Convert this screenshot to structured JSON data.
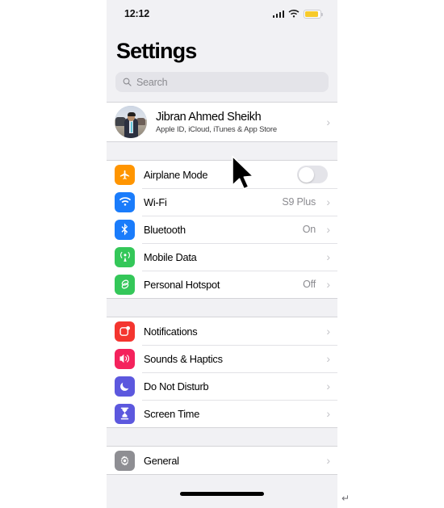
{
  "status_bar": {
    "time": "12:12",
    "signal_icon": "cellular-signal-icon",
    "wifi_icon": "wifi-icon",
    "battery_icon": "battery-icon",
    "battery_color": "#f7ca2b"
  },
  "header": {
    "title": "Settings"
  },
  "search": {
    "placeholder": "Search",
    "icon": "search-icon"
  },
  "profile": {
    "name": "Jibran Ahmed Sheikh",
    "subtitle": "Apple ID, iCloud, iTunes & App Store",
    "avatar": "user-avatar-photo",
    "chevron": "chevron-right-icon"
  },
  "groups": [
    {
      "id": "connectivity",
      "rows": [
        {
          "label": "Airplane Mode",
          "icon": "airplane-icon",
          "icon_color": "#FF9500",
          "control": "toggle",
          "toggle_on": false
        },
        {
          "label": "Wi-Fi",
          "icon": "wifi-icon",
          "icon_color": "#1A7CFB",
          "value": "S9 Plus",
          "control": "chevron"
        },
        {
          "label": "Bluetooth",
          "icon": "bluetooth-icon",
          "icon_color": "#1A7CFB",
          "value": "On",
          "control": "chevron"
        },
        {
          "label": "Mobile Data",
          "icon": "cellular-antenna-icon",
          "icon_color": "#34C759",
          "value": "",
          "control": "chevron"
        },
        {
          "label": "Personal Hotspot",
          "icon": "hotspot-link-icon",
          "icon_color": "#34C759",
          "value": "Off",
          "control": "chevron"
        }
      ]
    },
    {
      "id": "alerts",
      "rows": [
        {
          "label": "Notifications",
          "icon": "notifications-icon",
          "icon_color": "#F4352F",
          "value": "",
          "control": "chevron"
        },
        {
          "label": "Sounds & Haptics",
          "icon": "speaker-icon",
          "icon_color": "#F4225C",
          "value": "",
          "control": "chevron"
        },
        {
          "label": "Do Not Disturb",
          "icon": "moon-icon",
          "icon_color": "#5C58DE",
          "value": "",
          "control": "chevron"
        },
        {
          "label": "Screen Time",
          "icon": "hourglass-icon",
          "icon_color": "#5C58DE",
          "value": "",
          "control": "chevron"
        }
      ]
    },
    {
      "id": "system",
      "rows": [
        {
          "label": "General",
          "icon": "gear-icon",
          "icon_color": "#8E8E93",
          "value": "",
          "control": "chevron"
        }
      ]
    }
  ],
  "overlay": {
    "cursor": "mouse-cursor",
    "home_indicator": "home-indicator-bar",
    "return_glyph": "↵"
  },
  "chevron_glyph": "›"
}
